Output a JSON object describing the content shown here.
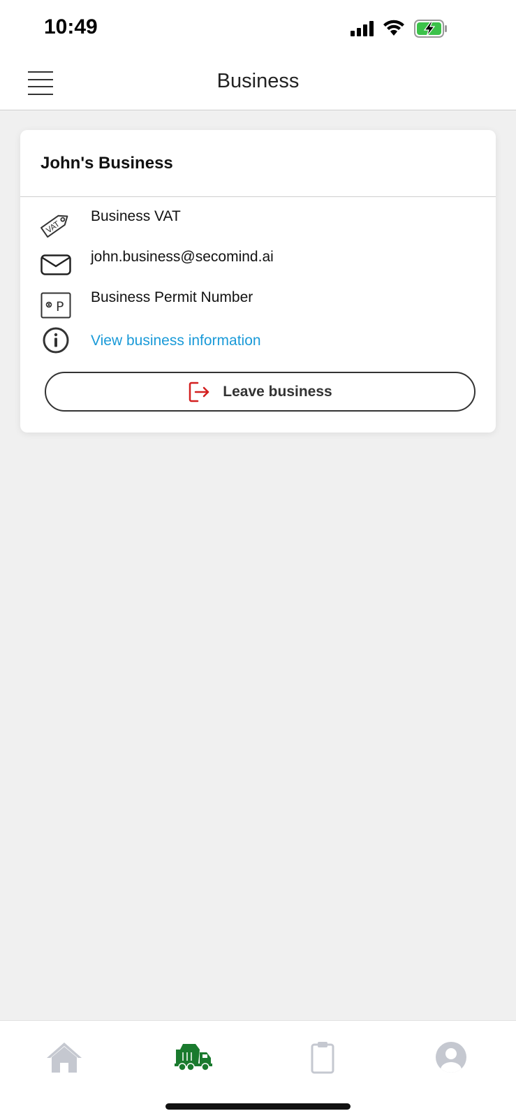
{
  "status_bar": {
    "time": "10:49",
    "icons": [
      "signal-icon",
      "wifi-icon",
      "battery-charging-icon"
    ]
  },
  "header": {
    "title": "Business",
    "menu_icon": "hamburger-menu-icon"
  },
  "business_card": {
    "name": "John's Business",
    "rows": [
      {
        "icon": "vat-tag-icon",
        "text": "Business VAT"
      },
      {
        "icon": "envelope-icon",
        "text": "john.business@secomind.ai"
      },
      {
        "icon": "permit-p-icon",
        "text": "Business Permit Number"
      },
      {
        "icon": "info-icon",
        "link": "View business information"
      }
    ],
    "leave_button": {
      "label": "Leave business",
      "icon": "exit-door-icon"
    }
  },
  "bottom_nav": {
    "items": [
      {
        "name": "home",
        "icon": "home-icon",
        "active": false
      },
      {
        "name": "truck",
        "icon": "truck-icon",
        "active": true
      },
      {
        "name": "clipboard",
        "icon": "clipboard-icon",
        "active": false
      },
      {
        "name": "profile",
        "icon": "user-profile-icon",
        "active": false
      }
    ]
  },
  "colors": {
    "link": "#1a9ad8",
    "active_nav": "#1a7a2e",
    "inactive_nav": "#c5c8d0",
    "leave_icon": "#d32020",
    "battery_fill": "#3cc24a"
  }
}
